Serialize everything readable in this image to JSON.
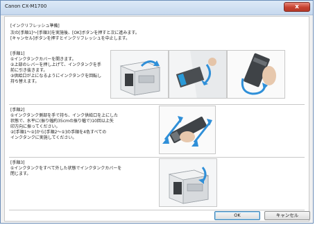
{
  "window": {
    "title": "Canon CX-M1700",
    "close_glyph": "x"
  },
  "intro": {
    "heading": "[インクリフレッシュ準備]",
    "line1": "次の[手順1]～[手順3]を実施後、[OK]ボタンを押すと次に進みます。",
    "line2": "[キャンセル]ボタンを押すとインクリフレッシュを中止します。"
  },
  "step1": {
    "lines": [
      "[手順1]",
      "①インクタンクカバーを開きます。",
      "②上部のレバーを押し上げて、インクタンクを手",
      "前に引き抜きます。",
      "③供給口が上になるようにインクタンクを回転し",
      "持ち替えます。"
    ]
  },
  "step2": {
    "lines": [
      "[手順2]",
      "①インクタンク側部を手で持ち、インク供給口を上にした",
      "状態で、水平に(振り幅約35cmの振り幅で)10回以上矢",
      "印方向に振ってください。",
      "②[手順1～②]から[手順2～①]の手順を4色すべての",
      "インクタンクに実施してください。"
    ]
  },
  "step3": {
    "lines": [
      "[手順3]",
      "①インクタンクをすべて外した状態でインクタンクカバーを",
      "閉じます。"
    ]
  },
  "buttons": {
    "ok": "OK",
    "cancel": "キャンセル"
  },
  "colors": {
    "accent": "#2f8fd8",
    "close": "#c5412f"
  }
}
